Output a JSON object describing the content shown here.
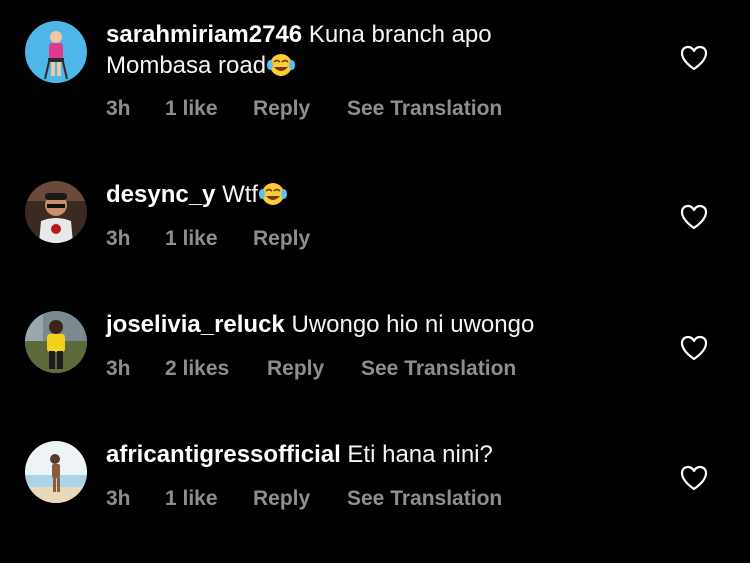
{
  "comments": [
    {
      "username": "sarahmiriam2746",
      "text_line1": "Kuna branch apo",
      "text_line2": "Mombasa road",
      "emoji": "face-with-tears-of-joy-emoji",
      "time": "3h",
      "likes": "1 like",
      "reply": "Reply",
      "translation": "See Translation"
    },
    {
      "username": "desync_y",
      "text": "Wtf",
      "emoji": "face-with-tears-of-joy-emoji",
      "time": "3h",
      "likes": "1 like",
      "reply": "Reply"
    },
    {
      "username": "joselivia_reluck",
      "text": "Uwongo hio ni uwongo",
      "time": "3h",
      "likes": "2 likes",
      "reply": "Reply",
      "translation": "See Translation"
    },
    {
      "username": "africantigressofficial",
      "text": "Eti hana nini?",
      "time": "3h",
      "likes": "1 like",
      "reply": "Reply",
      "translation": "See Translation"
    }
  ],
  "icons": {
    "like": "heart-outline-icon"
  },
  "colors": {
    "background": "#000000",
    "text": "#ffffff",
    "meta": "#8e8e8e"
  }
}
